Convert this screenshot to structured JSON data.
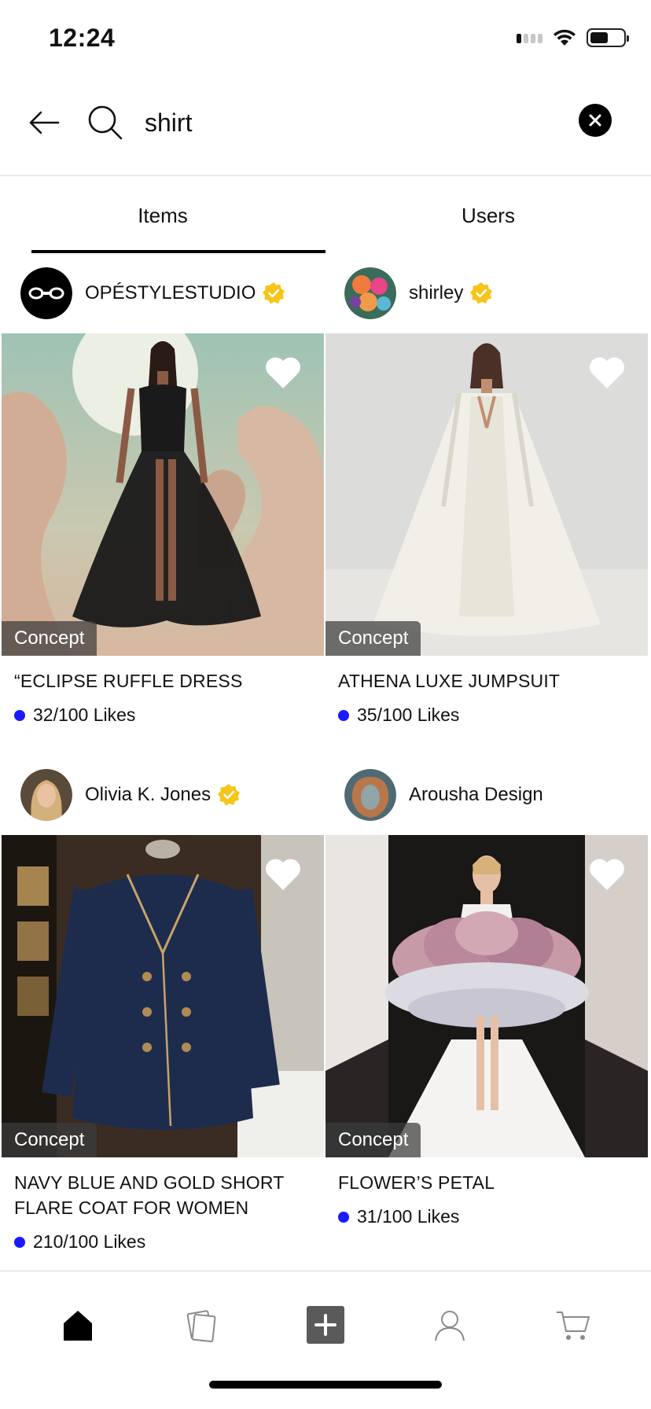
{
  "status_bar": {
    "time": "12:24",
    "battery_level": 0.55
  },
  "search": {
    "value": "shirt",
    "placeholder": ""
  },
  "tabs": [
    {
      "label": "Items",
      "active": true
    },
    {
      "label": "Users",
      "active": false
    }
  ],
  "items": [
    {
      "user": "OPÉSTYLESTUDIO",
      "verified": true,
      "badge": "Concept",
      "title": "“ECLIPSE RUFFLE DRESS",
      "likes": "32/100 Likes",
      "liked": false
    },
    {
      "user": "shirley",
      "verified": true,
      "badge": "Concept",
      "title": "ATHENA LUXE JUMPSUIT",
      "likes": "35/100 Likes",
      "liked": false
    },
    {
      "user": "Olivia K. Jones",
      "verified": true,
      "badge": "Concept",
      "title": "NAVY BLUE AND GOLD SHORT FLARE COAT FOR WOMEN",
      "likes": "210/100 Likes",
      "liked": false
    },
    {
      "user": "Arousha Design",
      "verified": false,
      "badge": "Concept",
      "title": "FLOWER’S PETAL",
      "likes": "31/100 Likes",
      "liked": false
    }
  ],
  "bottom_nav": [
    {
      "icon": "home-icon",
      "active": true
    },
    {
      "icon": "cards-icon",
      "active": false
    },
    {
      "icon": "add-icon",
      "active": false
    },
    {
      "icon": "profile-icon",
      "active": false
    },
    {
      "icon": "cart-icon",
      "active": false
    }
  ],
  "colors": {
    "accent": "#000000",
    "likes_dot": "#1a1aff",
    "verified": "#f5c518"
  }
}
